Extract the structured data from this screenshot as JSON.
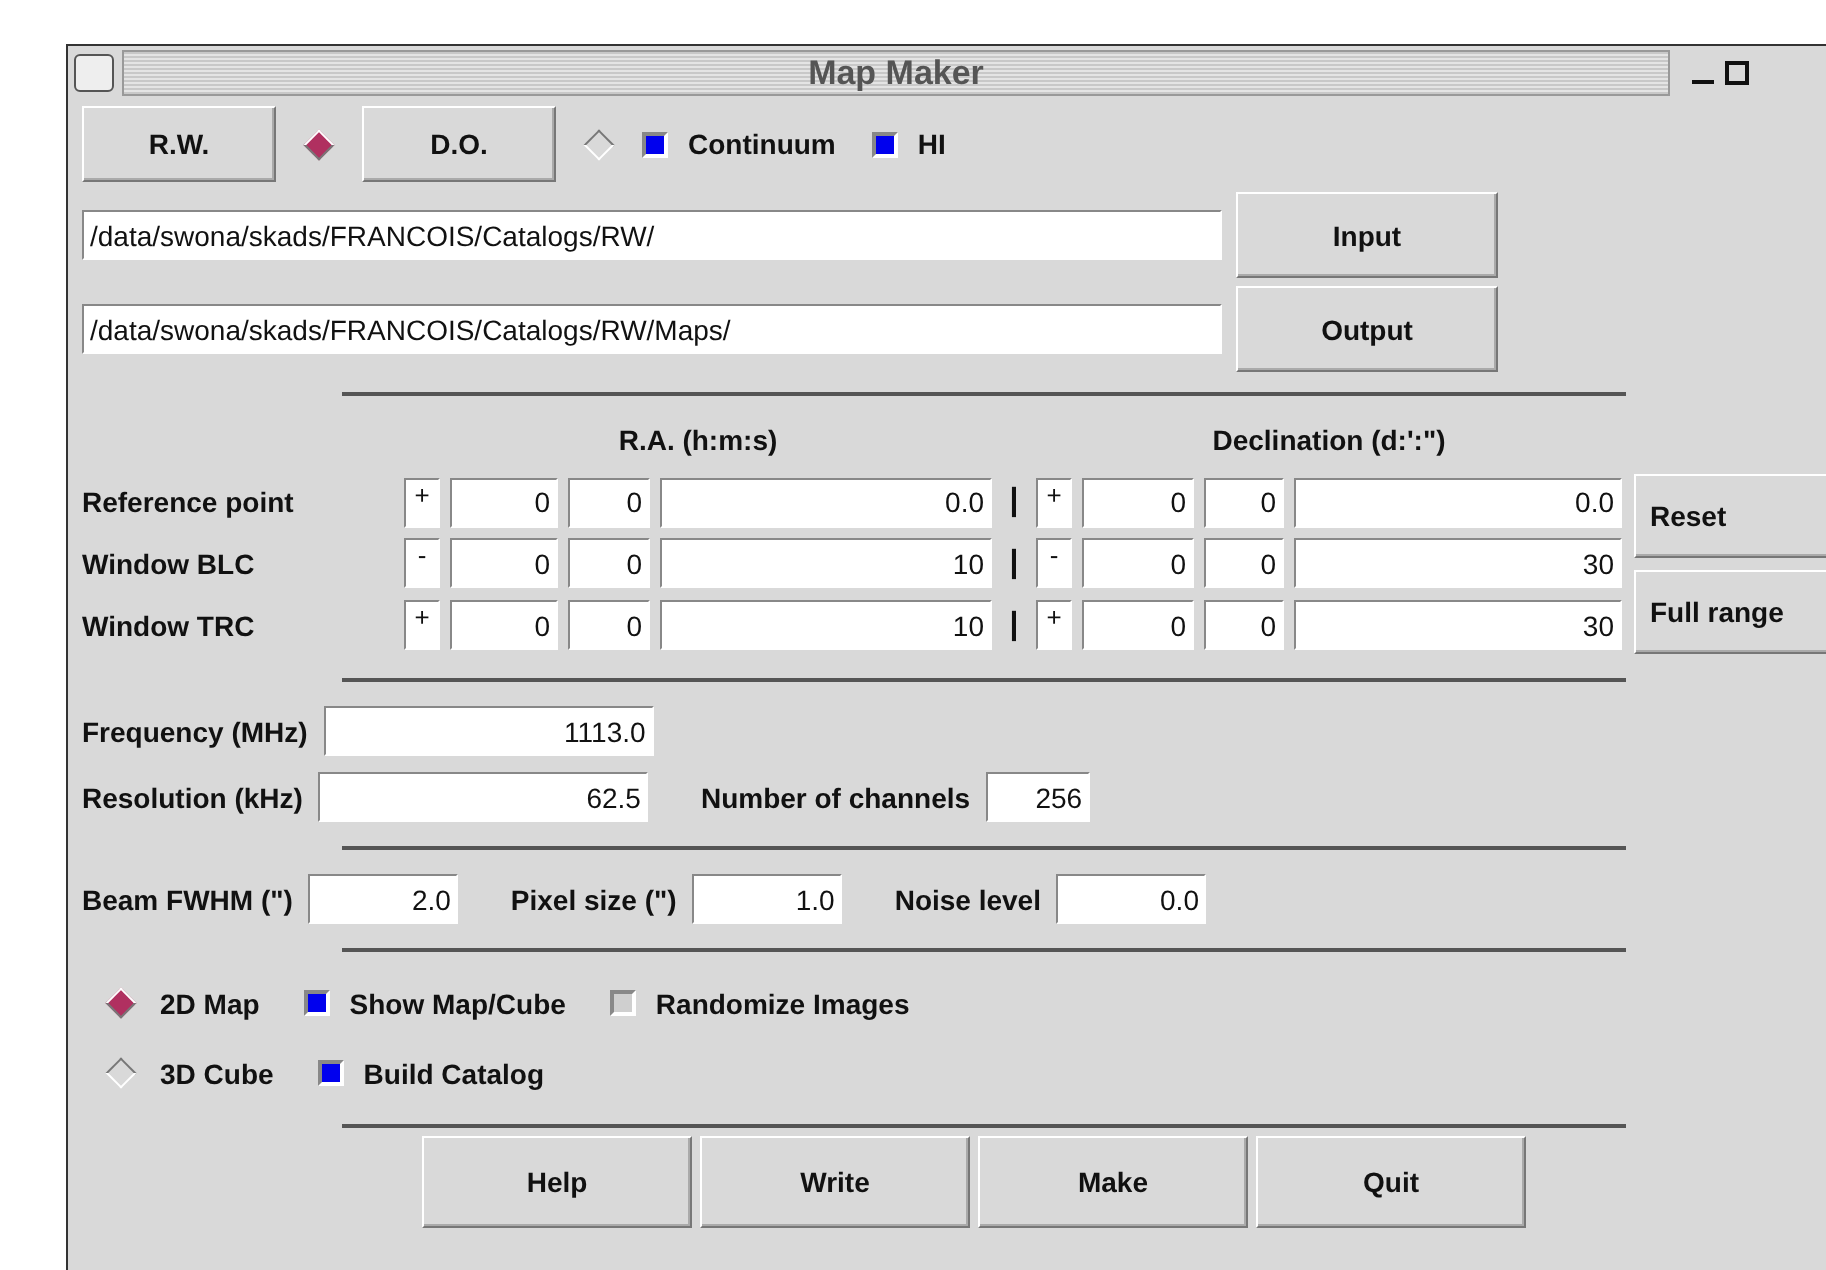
{
  "window": {
    "title": "Map Maker"
  },
  "sources": [
    {
      "label": "R.W.",
      "selected": true
    },
    {
      "label": "D.O.",
      "selected": false
    }
  ],
  "components": [
    {
      "label": "Continuum",
      "checked": true
    },
    {
      "label": "HI",
      "checked": true
    }
  ],
  "paths": [
    {
      "value": "/data/swona/skads/FRANCOIS/Catalogs/RW/",
      "button": "Input"
    },
    {
      "value": "/data/swona/skads/FRANCOIS/Catalogs/RW/Maps/",
      "button": "Output"
    }
  ],
  "coordinates": {
    "ra_heading": "R.A. (h:m:s)",
    "dec_heading": "Declination (d:':\")",
    "rows": [
      {
        "label": "Reference point",
        "ra_sign": "+",
        "ra": [
          "0",
          "0",
          "0.0"
        ],
        "separator": "|",
        "dec_sign": "+",
        "dec": [
          "0",
          "0",
          "0.0"
        ]
      },
      {
        "label": "Window BLC",
        "ra_sign": "-",
        "ra": [
          "0",
          "0",
          "10"
        ],
        "separator": "|",
        "dec_sign": "-",
        "dec": [
          "0",
          "0",
          "30"
        ]
      },
      {
        "label": "Window TRC",
        "ra_sign": "+",
        "ra": [
          "0",
          "0",
          "10"
        ],
        "separator": "|",
        "dec_sign": "+",
        "dec": [
          "0",
          "0",
          "30"
        ]
      }
    ]
  },
  "side_buttons": [
    "Reset",
    "Full range"
  ],
  "spectral_rows": [
    [
      {
        "label": "Frequency (MHz)",
        "value": "1113.0"
      }
    ],
    [
      {
        "label": "Resolution (kHz)",
        "value": "62.5"
      },
      {
        "label": "Number of channels",
        "value": "256"
      }
    ]
  ],
  "beam_row": [
    {
      "label": "Beam FWHM (\")",
      "value": "2.0"
    },
    {
      "label": "Pixel size (\")",
      "value": "1.0"
    },
    {
      "label": "Noise level",
      "value": "0.0"
    }
  ],
  "option_rows": [
    {
      "radio": {
        "label": "2D Map",
        "selected": true
      },
      "checks": [
        {
          "label": "Show Map/Cube",
          "checked": true
        },
        {
          "label": "Randomize Images",
          "checked": false
        }
      ]
    },
    {
      "radio": {
        "label": "3D Cube",
        "selected": false
      },
      "checks": [
        {
          "label": "Build Catalog",
          "checked": true
        }
      ]
    }
  ],
  "buttons": [
    "Help",
    "Write",
    "Make",
    "Quit"
  ]
}
